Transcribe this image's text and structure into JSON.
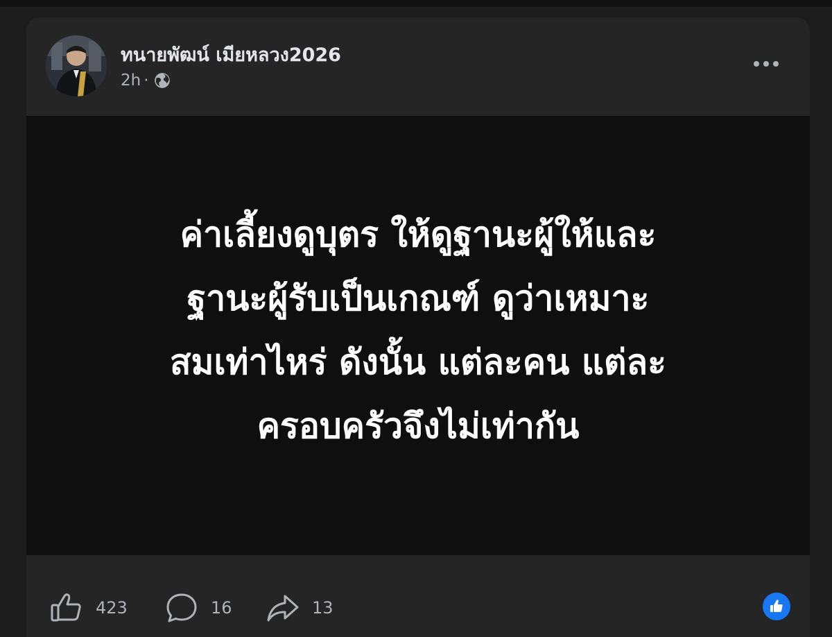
{
  "post": {
    "author": "ทนายพัฒน์ เมียหลวง2026",
    "time": "2h",
    "separator": "·",
    "visibility_icon": "globe-icon",
    "more_icon": "more-options-icon",
    "text_lines": [
      "ค่าเลี้ยงดูบุตร ให้ดูฐานะผู้ให้และ",
      "ฐานะผู้รับเป็นเกณฑ์ ดูว่าเหมาะ",
      "สมเท่าไหร่ ดังนั้น แต่ละคน แต่ละ",
      "ครอบครัวจึงไม่เท่ากัน"
    ],
    "background_color": "#0f0f10",
    "text_color": "#ffffff"
  },
  "actions": {
    "likes": "423",
    "comments": "16",
    "shares": "13"
  },
  "reaction": {
    "icon": "like-reaction-icon",
    "color": "#1877f2"
  }
}
